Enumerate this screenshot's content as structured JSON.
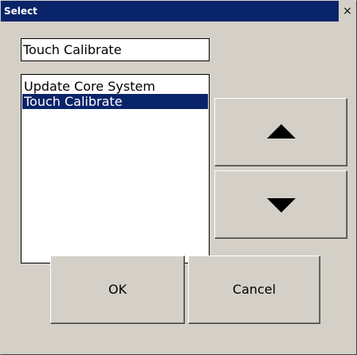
{
  "window": {
    "title": "Select",
    "close_glyph": "×"
  },
  "edit_field": {
    "value": "Touch Calibrate"
  },
  "list": {
    "items": [
      {
        "label": "Update Core System",
        "selected": false
      },
      {
        "label": "Touch Calibrate",
        "selected": true
      }
    ]
  },
  "buttons": {
    "up_icon": "triangle-up",
    "down_icon": "triangle-down",
    "ok_label": "OK",
    "cancel_label": "Cancel"
  },
  "colors": {
    "titlebar": "#0a246a",
    "selection": "#0a246a",
    "face": "#d4d0c8"
  }
}
